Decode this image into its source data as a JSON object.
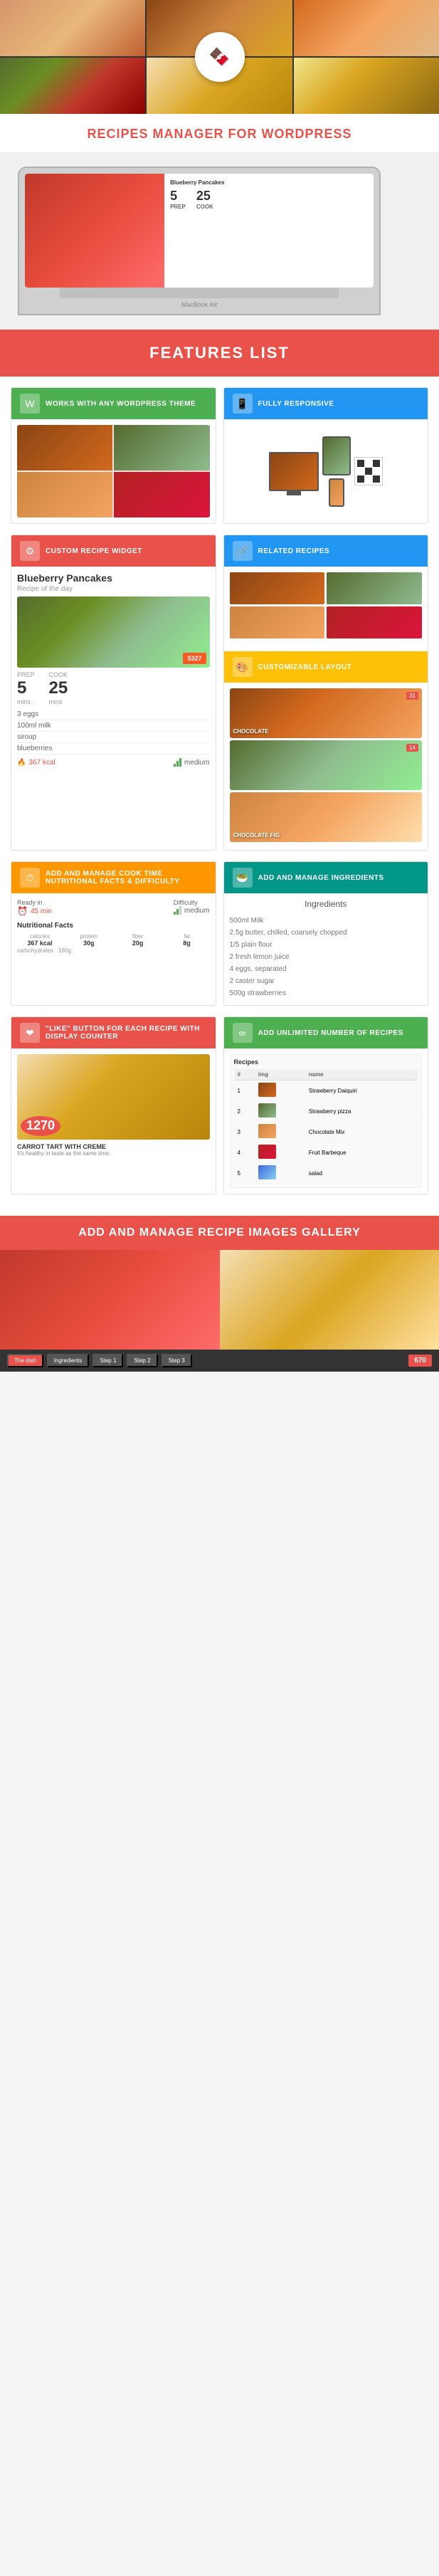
{
  "hero": {
    "logo_emoji": "🍫"
  },
  "title_section": {
    "title": "RECIPES MANAGER FOR WORDPRESS"
  },
  "macbook": {
    "label": "MacBook Air",
    "recipe_title": "Blueberry Pancakes",
    "prep_label": "PREP",
    "cook_label": "COOK",
    "prep_value": "5",
    "cook_value": "25"
  },
  "features_banner": {
    "title": "FEATURES LIST"
  },
  "feature_wordpress": {
    "title": "WORKS WITH ANY WORDPRESS THEME",
    "icon": "W"
  },
  "feature_responsive": {
    "title": "FULLY RESPONSIVE",
    "icon": "📱"
  },
  "feature_widget": {
    "title": "CUSTOM RECIPE WIDGET",
    "icon": "⚙"
  },
  "feature_related": {
    "title": "RELATED RECIPES",
    "icon": "🔗"
  },
  "feature_layout": {
    "title": "CUSTOMIZABLE LAYOUT",
    "icon": "🎨"
  },
  "recipe_card": {
    "name": "Blueberry Pancakes",
    "subtitle": "Recipe of the day",
    "prep_label": "PREP",
    "cook_label": "COOK",
    "prep_value": "5",
    "cook_value": "25",
    "prep_unit": "mins",
    "cook_unit": "mins",
    "ingredients": [
      "3 eggs",
      "100ml milk",
      "siroup",
      "blueberries"
    ],
    "calories": "367 kcal",
    "difficulty": "medium",
    "badge": "5327"
  },
  "feature_cooktime": {
    "title": "ADD AND MANAGE COOK TIME NUTRITIONAL FACTS & DIFFICULTY",
    "ready_label": "Ready in",
    "ready_value": "45 min",
    "difficulty_label": "Difficulty",
    "difficulty_value": "medium",
    "nf_title": "Nutritional Facts",
    "nf_calories_label": "calories",
    "nf_calories_value": "367 kcal",
    "nf_protein_label": "protein",
    "nf_protein_value": "30g",
    "nf_fiber_label": "fiber",
    "nf_fiber_value": "20g",
    "nf_fat_label": "fat",
    "nf_fat_value": "8g",
    "nf_carbs_label": "carbohydrates",
    "nf_carbs_value": "180g"
  },
  "feature_ingredients": {
    "title": "ADD AND MANAGE INGREDIENTS",
    "section_title": "Ingredients",
    "items": [
      "500ml Milk",
      "2.5g butter, chilled, coarsely chopped",
      "1/5 plain flour",
      "2 fresh lemon juice",
      "4 eggs, separated",
      "2 caster sugar",
      "500g strawberries"
    ]
  },
  "feature_like": {
    "title": "\"LIKE\" BUTTON FOR EACH RECIPE WITH DISPLAY COUNTER",
    "recipe_name": "CARROT TART WITH CREME",
    "recipe_number": "1270",
    "subtitle": "It's healthy in taste as the same time."
  },
  "feature_unlimited": {
    "title": "ADD UNLIMITED NUMBER OF RECIPES",
    "table_header_recipes": "Recipes",
    "recipes": [
      {
        "name": "Strawberry Daiquiri",
        "thumb": "thumb-1"
      },
      {
        "name": "Strawberry pizza",
        "thumb": "thumb-2"
      },
      {
        "name": "Chocolate Mix",
        "thumb": "thumb-3"
      },
      {
        "name": "Fruit Barbeque",
        "thumb": "thumb-4"
      },
      {
        "name": "salad",
        "thumb": "thumb-5"
      }
    ]
  },
  "gallery_section": {
    "title": "ADD AND MANAGE RECIPE IMAGES GALLERY",
    "nav_buttons": [
      "The dish",
      "Ingredients",
      "Step 1",
      "Step 2",
      "Step 3"
    ],
    "count": "670"
  }
}
